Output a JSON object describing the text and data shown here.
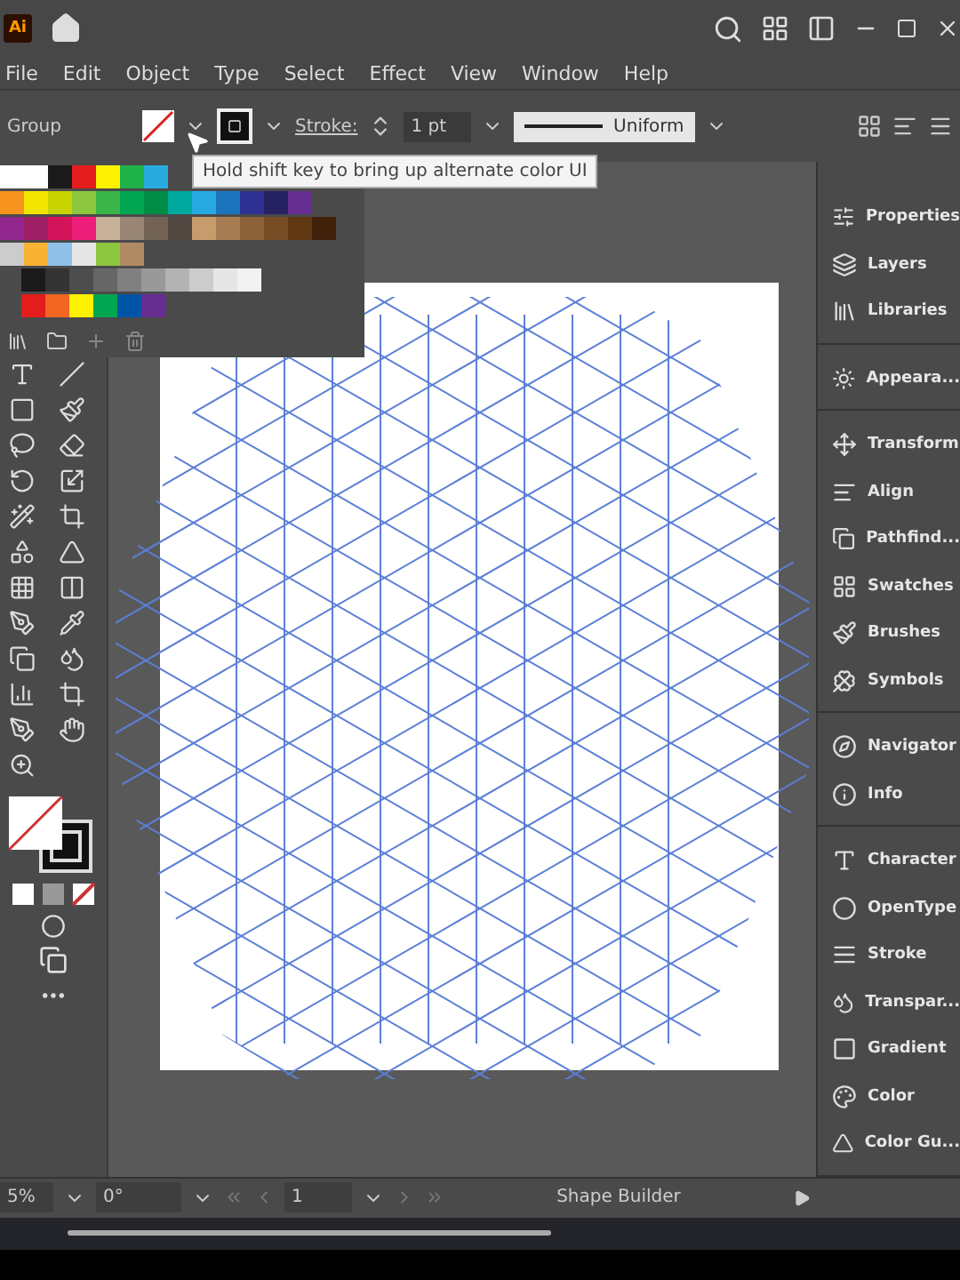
{
  "app_bar": {
    "logo": "Ai"
  },
  "menu": [
    "File",
    "Edit",
    "Object",
    "Type",
    "Select",
    "Effect",
    "View",
    "Window",
    "Help"
  ],
  "control_bar": {
    "selection": "Group",
    "stroke_label": "Stroke:",
    "stroke_weight": "1 pt",
    "profile": "Uniform"
  },
  "tooltip": "Hold shift key to bring up alternate color UI",
  "panels": [
    {
      "items": [
        {
          "kind": "properties",
          "label": "Properties"
        },
        {
          "kind": "layers",
          "label": "Layers"
        },
        {
          "kind": "libraries",
          "label": "Libraries"
        }
      ]
    },
    {
      "items": [
        {
          "kind": "appearance",
          "label": "Appeara..."
        }
      ]
    },
    {
      "items": [
        {
          "kind": "transform",
          "label": "Transform"
        },
        {
          "kind": "align",
          "label": "Align"
        },
        {
          "kind": "pathfinder",
          "label": "Pathfind..."
        },
        {
          "kind": "swatches",
          "label": "Swatches"
        },
        {
          "kind": "brushes",
          "label": "Brushes"
        },
        {
          "kind": "symbols",
          "label": "Symbols"
        }
      ]
    },
    {
      "items": [
        {
          "kind": "navigator",
          "label": "Navigator"
        },
        {
          "kind": "info",
          "label": "Info"
        }
      ]
    },
    {
      "items": [
        {
          "kind": "character",
          "label": "Character"
        },
        {
          "kind": "opentype",
          "label": "OpenType"
        },
        {
          "kind": "stroke",
          "label": "Stroke"
        },
        {
          "kind": "transparency",
          "label": "Transpar..."
        },
        {
          "kind": "gradient",
          "label": "Gradient"
        },
        {
          "kind": "color",
          "label": "Color"
        },
        {
          "kind": "colorguide",
          "label": "Color Gu..."
        }
      ]
    }
  ],
  "status_bar": {
    "zoom": "5%",
    "rotation": "0°",
    "artboard": "1",
    "tool": "Shape Builder"
  }
}
